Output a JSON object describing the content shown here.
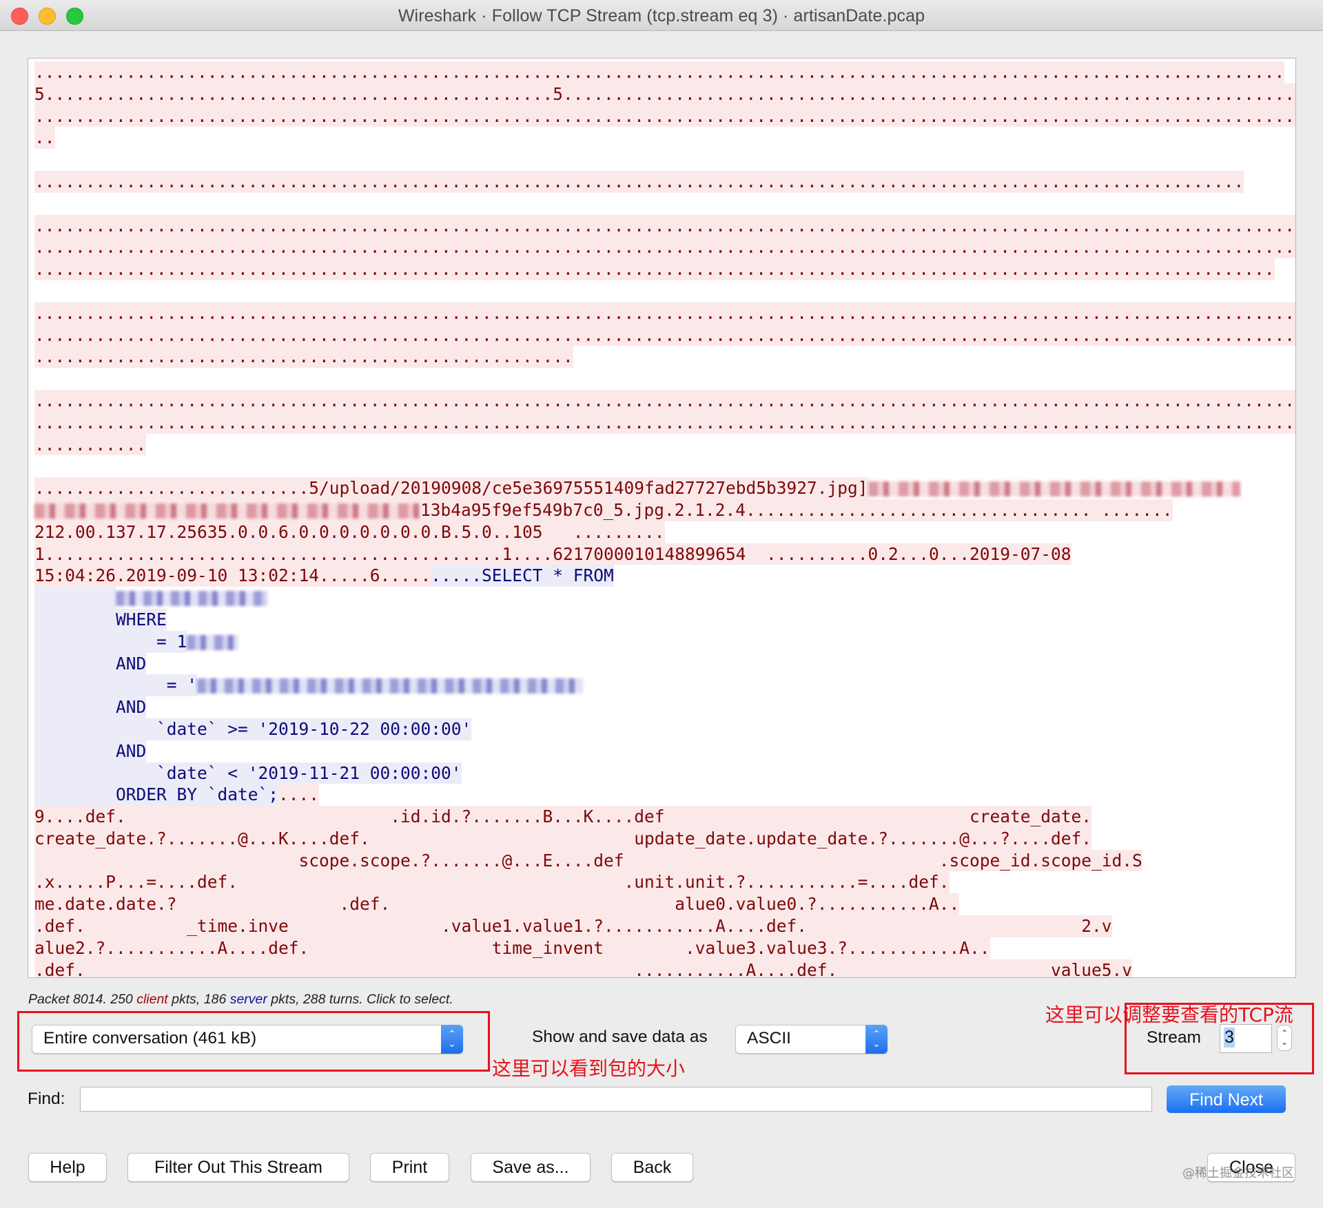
{
  "window": {
    "title": "Wireshark · Follow TCP Stream (tcp.stream eq 3) · artisanDate.pcap"
  },
  "stream_view": {
    "lines": [
      {
        "dir": "client",
        "text": "..........................................................................................................................."
      },
      {
        "dir": "client",
        "text": "5..................................................5..........................................................................."
      },
      {
        "dir": "client",
        "text": "................................................................................................................................"
      },
      {
        "dir": "client",
        "text": ".."
      },
      {
        "dir": "none",
        "text": ""
      },
      {
        "dir": "client",
        "text": "......................................................................................................................."
      },
      {
        "dir": "none",
        "text": ""
      },
      {
        "dir": "client",
        "text": "................................................................................................................................"
      },
      {
        "dir": "client",
        "text": "................................................................................................................................"
      },
      {
        "dir": "client",
        "text": ".........................................................................................................................."
      },
      {
        "dir": "none",
        "text": ""
      },
      {
        "dir": "client",
        "text": "................................................................................................................................"
      },
      {
        "dir": "client",
        "text": "................................................................................................................................"
      },
      {
        "dir": "client",
        "text": "....................................................."
      },
      {
        "dir": "none",
        "text": ""
      },
      {
        "dir": "client",
        "text": "................................................................................................................................"
      },
      {
        "dir": "client",
        "text": "................................................................................................................................"
      },
      {
        "dir": "client",
        "text": "..........."
      },
      {
        "dir": "none",
        "text": ""
      },
      {
        "dir": "client",
        "text": "...........................5/upload/20190908/ce5e36975551409fad27727ebd5b3927.jpg]"
      },
      {
        "dir": "client",
        "text": "13b4a95f9ef549b7c0_5.jpg.2.1.2.4.................................. ......."
      },
      {
        "dir": "client",
        "text": "212.00.137.17.25635.0.0.6.0.0.0.0.0.0.0.B.5.0..105   ........."
      },
      {
        "dir": "client",
        "text": "1.............................................1....6217000010148899654  ..........0.2...0...2019-07-08"
      },
      {
        "dir": "mixed",
        "client_text": "15:04:26.2019-09-10 13:02:14.....6.....",
        "server_text": ".....SELECT * FROM"
      },
      {
        "dir": "server",
        "text": "        "
      },
      {
        "dir": "server",
        "text": "        WHERE"
      },
      {
        "dir": "server",
        "text": "            = 1"
      },
      {
        "dir": "server",
        "text": "        AND"
      },
      {
        "dir": "server",
        "text": "             = '"
      },
      {
        "dir": "server",
        "text": "        AND"
      },
      {
        "dir": "server",
        "text": "            `date` >= '2019-10-22 00:00:00'"
      },
      {
        "dir": "server",
        "text": "        AND"
      },
      {
        "dir": "server",
        "text": "            `date` < '2019-11-21 00:00:00'"
      },
      {
        "dir": "mixed",
        "server_text": "        ORDER BY `date`;",
        "client_text": "...."
      },
      {
        "dir": "client",
        "text": "9....def.                          .id.id.?.......B...K....def                              create_date."
      },
      {
        "dir": "client",
        "text": "create_date.?.......@...K....def.                          update_date.update_date.?.......@...?....def."
      },
      {
        "dir": "client",
        "text": "                          scope.scope.?.......@...E....def                               .scope_id.scope_id.S"
      },
      {
        "dir": "client",
        "text": ".x.....P...=....def.                                      .unit.unit.?...........=....def."
      },
      {
        "dir": "client",
        "text": "me.date.date.?                .def.                            alue0.value0.?...........A.."
      },
      {
        "dir": "client",
        "text": ".def.          _time.inve               .value1.value1.?...........A....def.                           2.v"
      },
      {
        "dir": "client",
        "text": "alue2.?...........A....def.                  time_invent        .value3.value3.?...........A.."
      },
      {
        "dir": "client",
        "text": ".def.                                                      ...........A....def.                     value5.v"
      }
    ]
  },
  "status": {
    "prefix": "Packet 8014. 250 ",
    "client_word": "client",
    "middle": " pkts, 186 ",
    "server_word": "server",
    "suffix": " pkts, 288 turns. Click to select."
  },
  "controls": {
    "conversation_select": "Entire conversation (461 kB)",
    "show_as_label": "Show and save data as",
    "show_as_select": "ASCII",
    "stream_label": "Stream",
    "stream_value": "3",
    "find_label": "Find:",
    "find_value": "",
    "find_next": "Find Next"
  },
  "buttons": {
    "help": "Help",
    "filter_out": "Filter Out This Stream",
    "print": "Print",
    "save_as": "Save as...",
    "back": "Back",
    "close": "Close"
  },
  "annotations": {
    "size_note": "这里可以看到包的大小",
    "stream_note": "这里可以调整要查看的TCP流"
  },
  "watermark": "@稀土掘金技术社区",
  "colors": {
    "client_fg": "#7e0808",
    "client_bg": "#fbe9ea",
    "server_fg": "#0c0c7a",
    "server_bg": "#ececf8",
    "annotation": "#e8111c",
    "accent": "#1a6ff1"
  }
}
